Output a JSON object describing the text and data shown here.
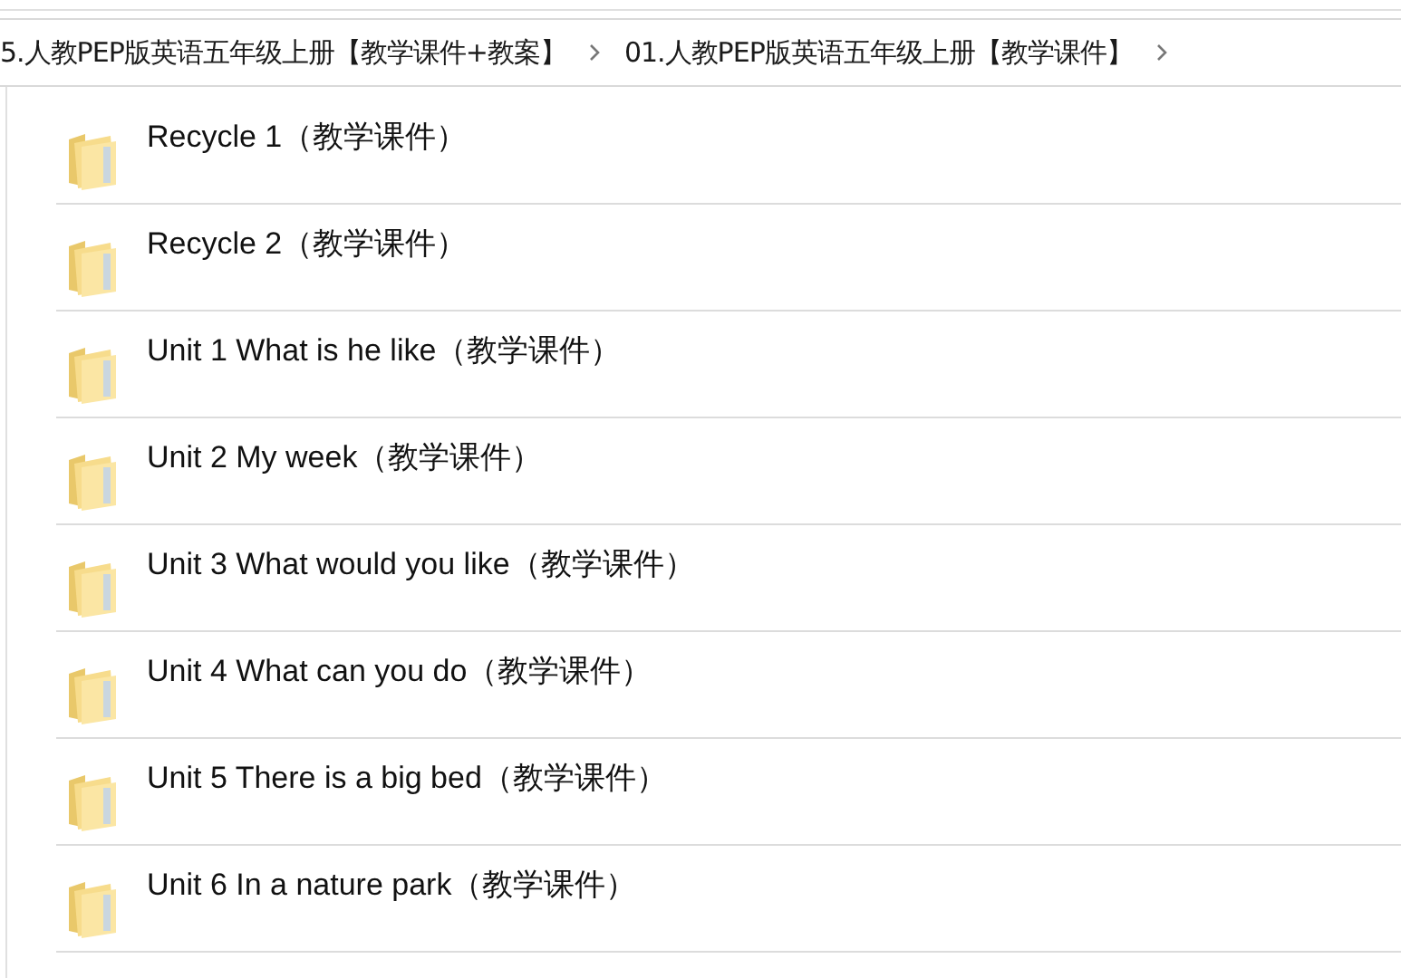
{
  "breadcrumb": [
    {
      "label": "5.人教PEP版英语五年级上册【教学课件+教案】"
    },
    {
      "label": "01.人教PEP版英语五年级上册【教学课件】"
    }
  ],
  "files": [
    {
      "name": "Recycle 1（教学课件）"
    },
    {
      "name": "Recycle 2（教学课件）"
    },
    {
      "name": "Unit 1 What is he like（教学课件）"
    },
    {
      "name": "Unit 2 My week（教学课件）"
    },
    {
      "name": "Unit 3 What would you like（教学课件）"
    },
    {
      "name": "Unit 4 What can you do（教学课件）"
    },
    {
      "name": "Unit 5 There is a big bed（教学课件）"
    },
    {
      "name": "Unit 6 In a nature park（教学课件）"
    }
  ]
}
